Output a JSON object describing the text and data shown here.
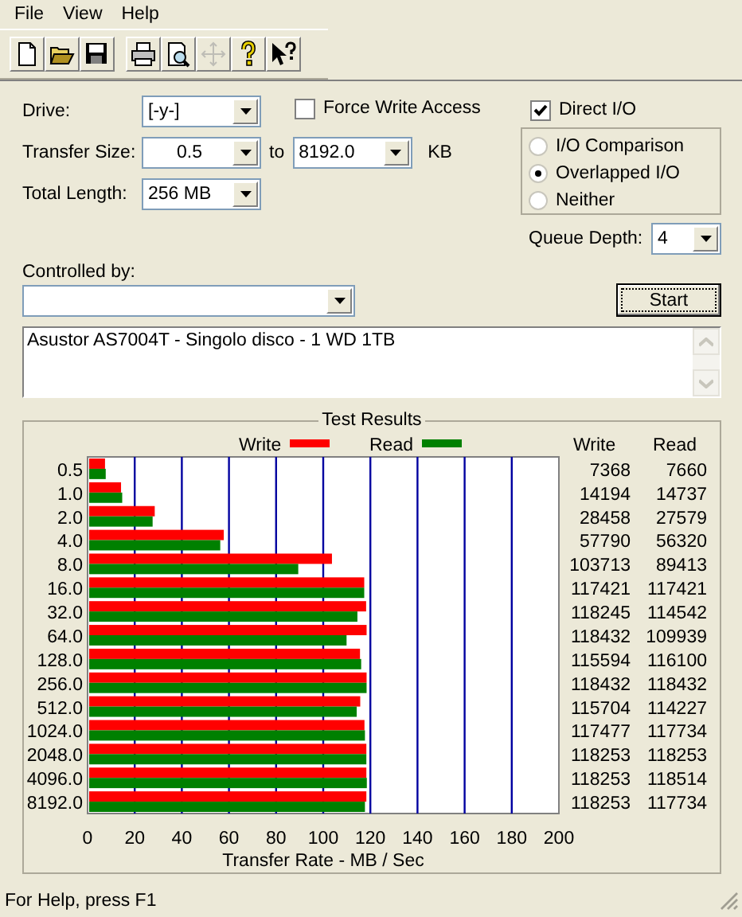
{
  "menu": [
    {
      "label": "File"
    },
    {
      "label": "View"
    },
    {
      "label": "Help"
    }
  ],
  "toolbar": [
    {
      "buttons": [
        {
          "kind": "new",
          "disabled": false
        },
        {
          "kind": "open",
          "disabled": false
        },
        {
          "kind": "save",
          "disabled": false
        }
      ]
    },
    {
      "buttons": [
        {
          "kind": "print",
          "disabled": false
        },
        {
          "kind": "preview",
          "disabled": false
        },
        {
          "kind": "move",
          "disabled": true
        },
        {
          "kind": "help",
          "disabled": false
        },
        {
          "kind": "context_help",
          "disabled": false
        }
      ]
    }
  ],
  "drive": {
    "label": "Drive:",
    "value": "[-y-]"
  },
  "transfer_size": {
    "label": "Transfer Size:",
    "from": "0.5",
    "to_label": "to",
    "to": "8192.0",
    "unit": "KB"
  },
  "total_length": {
    "label": "Total Length:",
    "value": "256 MB"
  },
  "force_write_access": {
    "label": "Force Write Access",
    "checked": false
  },
  "direct_io": {
    "label": "Direct I/O",
    "checked": true
  },
  "io_mode": [
    {
      "label": "I/O Comparison",
      "selected": false
    },
    {
      "label": "Overlapped I/O",
      "selected": true
    },
    {
      "label": "Neither",
      "selected": false
    }
  ],
  "queue_depth": {
    "label": "Queue Depth:",
    "value": "4"
  },
  "controlled_by": {
    "label": "Controlled by:"
  },
  "start_button": "Start",
  "description": "Asustor AS7004T - Singolo disco - 1 WD 1TB",
  "test_results": {
    "title": "Test Results",
    "value_headers": [
      "Write",
      "Read"
    ],
    "rows": [
      {
        "write": "7368",
        "read": "7660"
      },
      {
        "write": "14194",
        "read": "14737"
      },
      {
        "write": "28458",
        "read": "27579"
      },
      {
        "write": "57790",
        "read": "56320"
      },
      {
        "write": "103713",
        "read": "89413"
      },
      {
        "write": "117421",
        "read": "117421"
      },
      {
        "write": "118245",
        "read": "114542"
      },
      {
        "write": "118432",
        "read": "109939"
      },
      {
        "write": "115594",
        "read": "116100"
      },
      {
        "write": "118432",
        "read": "118432"
      },
      {
        "write": "115704",
        "read": "114227"
      },
      {
        "write": "117477",
        "read": "117734"
      },
      {
        "write": "118253",
        "read": "118253"
      },
      {
        "write": "118253",
        "read": "118514"
      },
      {
        "write": "118253",
        "read": "117734"
      }
    ],
    "chart_data": {
      "type": "bar",
      "orientation": "horizontal",
      "grid": true,
      "legend": true,
      "xlabel": "Transfer Rate - MB / Sec",
      "xlim": [
        0,
        200
      ],
      "xticks": [
        0,
        20,
        40,
        60,
        80,
        100,
        120,
        140,
        160,
        180,
        200
      ],
      "categories": [
        "0.5",
        "1.0",
        "2.0",
        "4.0",
        "8.0",
        "16.0",
        "32.0",
        "64.0",
        "128.0",
        "256.0",
        "512.0",
        "1024.0",
        "2048.0",
        "4096.0",
        "8192.0"
      ],
      "series": [
        {
          "name": "Write",
          "color": "#ff0000",
          "values": [
            7.4,
            14.2,
            28.5,
            57.8,
            103.7,
            117.4,
            118.2,
            118.4,
            115.6,
            118.4,
            115.7,
            117.5,
            118.3,
            118.3,
            118.3
          ]
        },
        {
          "name": "Read",
          "color": "#008000",
          "values": [
            7.7,
            14.7,
            27.6,
            56.3,
            89.4,
            117.4,
            114.5,
            109.9,
            116.1,
            118.4,
            114.2,
            117.7,
            118.3,
            118.5,
            117.7
          ]
        }
      ]
    }
  },
  "status_bar": "For Help, press F1"
}
